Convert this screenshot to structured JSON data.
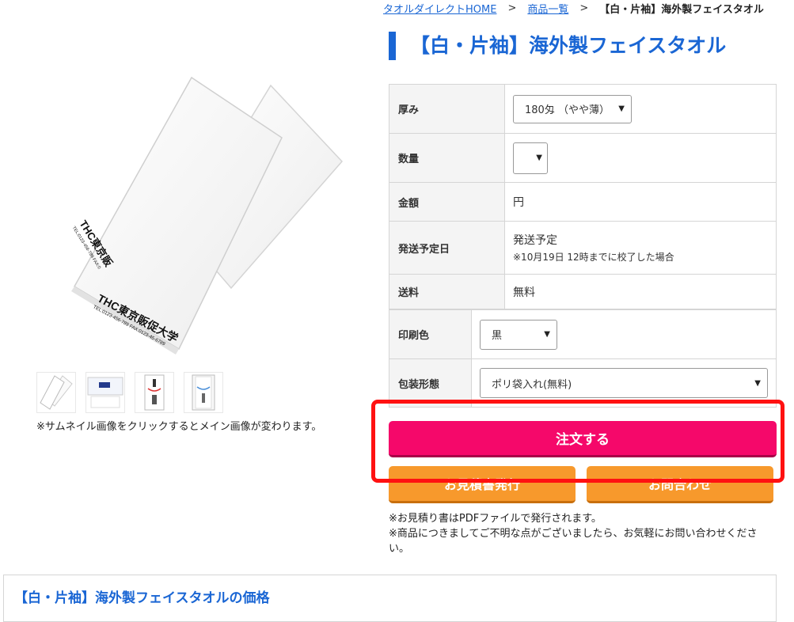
{
  "breadcrumb": {
    "home": "タオルダイレクトHOME",
    "list": "商品一覧",
    "current": "【白・片袖】海外製フェイスタオル",
    "separator": ">"
  },
  "page_title": "【白・片袖】海外製フェイスタオル",
  "product_image": {
    "print_text_1": "THC東京販促大学",
    "print_text_1_sub": "TEL:0123-456-789 FAX:0123-45-6789",
    "print_text_2": "THC東京販",
    "print_text_2_sub": "TEL:0123-456-789 FAX:0"
  },
  "thumbnail_note": "※サムネイル画像をクリックするとメイン画像が変わります。",
  "spec": {
    "thickness_label": "厚み",
    "thickness_value": "180匁 （やや薄）",
    "quantity_label": "数量",
    "quantity_value": "",
    "price_label": "金額",
    "price_value": "円",
    "ship_label": "発送予定日",
    "ship_value": "発送予定",
    "ship_note": "※10月19日 12時までに校了した場合",
    "shipping_fee_label": "送料",
    "shipping_fee_value": "無料"
  },
  "print_options": {
    "color_label": "印刷色",
    "color_value": "黒",
    "wrap_label": "包装形態",
    "wrap_value": "ポリ袋入れ(無料)"
  },
  "buttons": {
    "order": "注文する",
    "estimate": "お見積書発行",
    "contact": "お問合わせ"
  },
  "notes": [
    "※お見積り書はPDFファイルで発行されます。",
    "※商品につきましてご不明な点がございましたら、お気軽にお問い合わせください。"
  ],
  "bottom_title": "【白・片袖】海外製フェイスタオルの価格",
  "colors": {
    "accent_blue": "#1a66d4",
    "order_pink": "#f5086a",
    "sub_orange": "#f7992c",
    "highlight_red": "#ff1111"
  }
}
